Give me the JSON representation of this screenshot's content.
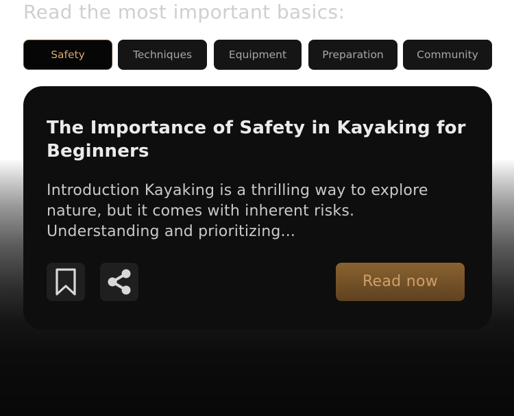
{
  "heading": "Read the most important basics:",
  "tabs": [
    {
      "label": "Safety",
      "active": true
    },
    {
      "label": "Techniques",
      "active": false
    },
    {
      "label": "Equipment",
      "active": false
    },
    {
      "label": "Preparation",
      "active": false
    },
    {
      "label": "Community",
      "active": false
    }
  ],
  "article": {
    "title": "The Importance of Safety in Kayaking for Beginners",
    "excerpt": "Introduction Kayaking is a thrilling way to explore nature, but it comes with inherent risks. Understanding and prioritizing...",
    "read_label": "Read now",
    "bookmark_icon": "bookmark-icon",
    "share_icon": "share-icon"
  },
  "colors": {
    "accent": "#d9a872",
    "button_gradient_top": "#8a6230",
    "button_gradient_bottom": "#5f4220",
    "card_background": "#0e0e0e",
    "tab_background": "#151515"
  }
}
